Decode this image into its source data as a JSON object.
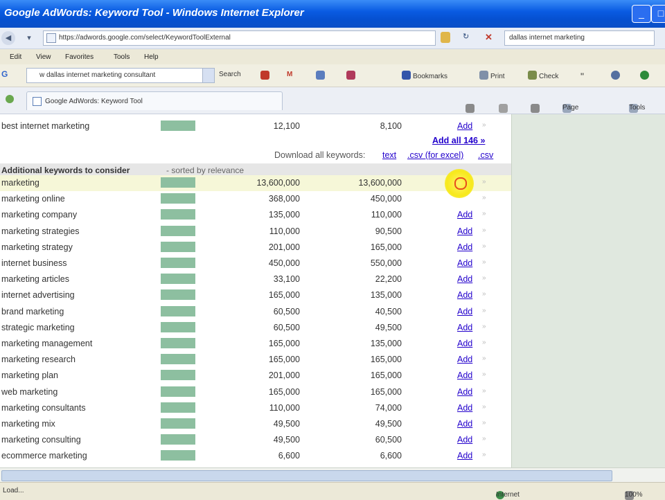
{
  "window": {
    "title": "Google AdWords: Keyword Tool - Windows Internet Explorer",
    "buttons": {
      "minimize": "_",
      "maximize": "□"
    }
  },
  "address_bar": {
    "url": "https://adwords.google.com/select/KeywordToolExternal",
    "search_value": "dallas internet marketing",
    "refresh": "↻",
    "stop": "✕"
  },
  "menu": {
    "items": [
      "Edit",
      "View",
      "Favorites",
      "Tools",
      "Help"
    ]
  },
  "toolbar": {
    "google_logo": "G",
    "search_value": "w dallas internet marketing consultant",
    "search_label": "Search",
    "mail_label": "M",
    "bookmarks_label": "Bookmarks",
    "print_label": "Print",
    "check_label": "Check",
    "quote_glyph": "\""
  },
  "tabs": {
    "active": "Google AdWords: Keyword Tool",
    "page_label": "Page",
    "tools_label": "Tools"
  },
  "top_row": {
    "keyword": "best internet marketing",
    "v1": "12,100",
    "v2": "8,100",
    "action": "Add"
  },
  "add_all": "Add all 146 »",
  "download": {
    "label": "Download all keywords:",
    "text": "text",
    "csv_excel": ".csv (for excel)",
    "csv": ".csv"
  },
  "section": {
    "heading": "Additional keywords to consider",
    "sorted": "- sorted by relevance"
  },
  "rows": [
    {
      "keyword": "marketing",
      "v1": "13,600,000",
      "v2": "13,600,000",
      "action": ""
    },
    {
      "keyword": "marketing online",
      "v1": "368,000",
      "v2": "450,000",
      "action": ""
    },
    {
      "keyword": "marketing company",
      "v1": "135,000",
      "v2": "110,000",
      "action": "Add"
    },
    {
      "keyword": "marketing strategies",
      "v1": "110,000",
      "v2": "90,500",
      "action": "Add"
    },
    {
      "keyword": "marketing strategy",
      "v1": "201,000",
      "v2": "165,000",
      "action": "Add"
    },
    {
      "keyword": "internet business",
      "v1": "450,000",
      "v2": "550,000",
      "action": "Add"
    },
    {
      "keyword": "marketing articles",
      "v1": "33,100",
      "v2": "22,200",
      "action": "Add"
    },
    {
      "keyword": "internet advertising",
      "v1": "165,000",
      "v2": "135,000",
      "action": "Add"
    },
    {
      "keyword": "brand marketing",
      "v1": "60,500",
      "v2": "40,500",
      "action": "Add"
    },
    {
      "keyword": "strategic marketing",
      "v1": "60,500",
      "v2": "49,500",
      "action": "Add"
    },
    {
      "keyword": "marketing management",
      "v1": "165,000",
      "v2": "135,000",
      "action": "Add"
    },
    {
      "keyword": "marketing research",
      "v1": "165,000",
      "v2": "165,000",
      "action": "Add"
    },
    {
      "keyword": "marketing plan",
      "v1": "201,000",
      "v2": "165,000",
      "action": "Add"
    },
    {
      "keyword": "web marketing",
      "v1": "165,000",
      "v2": "165,000",
      "action": "Add"
    },
    {
      "keyword": "marketing consultants",
      "v1": "110,000",
      "v2": "74,000",
      "action": "Add"
    },
    {
      "keyword": "marketing mix",
      "v1": "49,500",
      "v2": "49,500",
      "action": "Add"
    },
    {
      "keyword": "marketing consulting",
      "v1": "49,500",
      "v2": "60,500",
      "action": "Add"
    },
    {
      "keyword": "ecommerce marketing",
      "v1": "6,600",
      "v2": "6,600",
      "action": "Add"
    }
  ],
  "status": {
    "left": "Load...",
    "zone": "Internet",
    "zoom": "100%"
  },
  "colors": {
    "accent": "#0550D0",
    "bar": "#8DBFA0",
    "link": "#2200CC",
    "highlight": "#F6F7D8"
  }
}
